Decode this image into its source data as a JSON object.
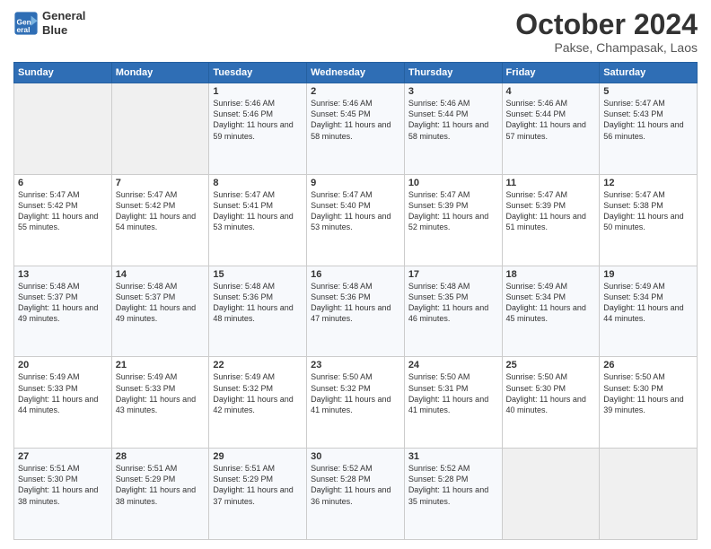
{
  "header": {
    "logo_line1": "General",
    "logo_line2": "Blue",
    "month_title": "October 2024",
    "location": "Pakse, Champasak, Laos"
  },
  "weekdays": [
    "Sunday",
    "Monday",
    "Tuesday",
    "Wednesday",
    "Thursday",
    "Friday",
    "Saturday"
  ],
  "weeks": [
    [
      {
        "day": "",
        "empty": true
      },
      {
        "day": "",
        "empty": true
      },
      {
        "day": "1",
        "sunrise": "Sunrise: 5:46 AM",
        "sunset": "Sunset: 5:46 PM",
        "daylight": "Daylight: 11 hours and 59 minutes."
      },
      {
        "day": "2",
        "sunrise": "Sunrise: 5:46 AM",
        "sunset": "Sunset: 5:45 PM",
        "daylight": "Daylight: 11 hours and 58 minutes."
      },
      {
        "day": "3",
        "sunrise": "Sunrise: 5:46 AM",
        "sunset": "Sunset: 5:44 PM",
        "daylight": "Daylight: 11 hours and 58 minutes."
      },
      {
        "day": "4",
        "sunrise": "Sunrise: 5:46 AM",
        "sunset": "Sunset: 5:44 PM",
        "daylight": "Daylight: 11 hours and 57 minutes."
      },
      {
        "day": "5",
        "sunrise": "Sunrise: 5:47 AM",
        "sunset": "Sunset: 5:43 PM",
        "daylight": "Daylight: 11 hours and 56 minutes."
      }
    ],
    [
      {
        "day": "6",
        "sunrise": "Sunrise: 5:47 AM",
        "sunset": "Sunset: 5:42 PM",
        "daylight": "Daylight: 11 hours and 55 minutes."
      },
      {
        "day": "7",
        "sunrise": "Sunrise: 5:47 AM",
        "sunset": "Sunset: 5:42 PM",
        "daylight": "Daylight: 11 hours and 54 minutes."
      },
      {
        "day": "8",
        "sunrise": "Sunrise: 5:47 AM",
        "sunset": "Sunset: 5:41 PM",
        "daylight": "Daylight: 11 hours and 53 minutes."
      },
      {
        "day": "9",
        "sunrise": "Sunrise: 5:47 AM",
        "sunset": "Sunset: 5:40 PM",
        "daylight": "Daylight: 11 hours and 53 minutes."
      },
      {
        "day": "10",
        "sunrise": "Sunrise: 5:47 AM",
        "sunset": "Sunset: 5:39 PM",
        "daylight": "Daylight: 11 hours and 52 minutes."
      },
      {
        "day": "11",
        "sunrise": "Sunrise: 5:47 AM",
        "sunset": "Sunset: 5:39 PM",
        "daylight": "Daylight: 11 hours and 51 minutes."
      },
      {
        "day": "12",
        "sunrise": "Sunrise: 5:47 AM",
        "sunset": "Sunset: 5:38 PM",
        "daylight": "Daylight: 11 hours and 50 minutes."
      }
    ],
    [
      {
        "day": "13",
        "sunrise": "Sunrise: 5:48 AM",
        "sunset": "Sunset: 5:37 PM",
        "daylight": "Daylight: 11 hours and 49 minutes."
      },
      {
        "day": "14",
        "sunrise": "Sunrise: 5:48 AM",
        "sunset": "Sunset: 5:37 PM",
        "daylight": "Daylight: 11 hours and 49 minutes."
      },
      {
        "day": "15",
        "sunrise": "Sunrise: 5:48 AM",
        "sunset": "Sunset: 5:36 PM",
        "daylight": "Daylight: 11 hours and 48 minutes."
      },
      {
        "day": "16",
        "sunrise": "Sunrise: 5:48 AM",
        "sunset": "Sunset: 5:36 PM",
        "daylight": "Daylight: 11 hours and 47 minutes."
      },
      {
        "day": "17",
        "sunrise": "Sunrise: 5:48 AM",
        "sunset": "Sunset: 5:35 PM",
        "daylight": "Daylight: 11 hours and 46 minutes."
      },
      {
        "day": "18",
        "sunrise": "Sunrise: 5:49 AM",
        "sunset": "Sunset: 5:34 PM",
        "daylight": "Daylight: 11 hours and 45 minutes."
      },
      {
        "day": "19",
        "sunrise": "Sunrise: 5:49 AM",
        "sunset": "Sunset: 5:34 PM",
        "daylight": "Daylight: 11 hours and 44 minutes."
      }
    ],
    [
      {
        "day": "20",
        "sunrise": "Sunrise: 5:49 AM",
        "sunset": "Sunset: 5:33 PM",
        "daylight": "Daylight: 11 hours and 44 minutes."
      },
      {
        "day": "21",
        "sunrise": "Sunrise: 5:49 AM",
        "sunset": "Sunset: 5:33 PM",
        "daylight": "Daylight: 11 hours and 43 minutes."
      },
      {
        "day": "22",
        "sunrise": "Sunrise: 5:49 AM",
        "sunset": "Sunset: 5:32 PM",
        "daylight": "Daylight: 11 hours and 42 minutes."
      },
      {
        "day": "23",
        "sunrise": "Sunrise: 5:50 AM",
        "sunset": "Sunset: 5:32 PM",
        "daylight": "Daylight: 11 hours and 41 minutes."
      },
      {
        "day": "24",
        "sunrise": "Sunrise: 5:50 AM",
        "sunset": "Sunset: 5:31 PM",
        "daylight": "Daylight: 11 hours and 41 minutes."
      },
      {
        "day": "25",
        "sunrise": "Sunrise: 5:50 AM",
        "sunset": "Sunset: 5:30 PM",
        "daylight": "Daylight: 11 hours and 40 minutes."
      },
      {
        "day": "26",
        "sunrise": "Sunrise: 5:50 AM",
        "sunset": "Sunset: 5:30 PM",
        "daylight": "Daylight: 11 hours and 39 minutes."
      }
    ],
    [
      {
        "day": "27",
        "sunrise": "Sunrise: 5:51 AM",
        "sunset": "Sunset: 5:30 PM",
        "daylight": "Daylight: 11 hours and 38 minutes."
      },
      {
        "day": "28",
        "sunrise": "Sunrise: 5:51 AM",
        "sunset": "Sunset: 5:29 PM",
        "daylight": "Daylight: 11 hours and 38 minutes."
      },
      {
        "day": "29",
        "sunrise": "Sunrise: 5:51 AM",
        "sunset": "Sunset: 5:29 PM",
        "daylight": "Daylight: 11 hours and 37 minutes."
      },
      {
        "day": "30",
        "sunrise": "Sunrise: 5:52 AM",
        "sunset": "Sunset: 5:28 PM",
        "daylight": "Daylight: 11 hours and 36 minutes."
      },
      {
        "day": "31",
        "sunrise": "Sunrise: 5:52 AM",
        "sunset": "Sunset: 5:28 PM",
        "daylight": "Daylight: 11 hours and 35 minutes."
      },
      {
        "day": "",
        "empty": true
      },
      {
        "day": "",
        "empty": true
      }
    ]
  ]
}
